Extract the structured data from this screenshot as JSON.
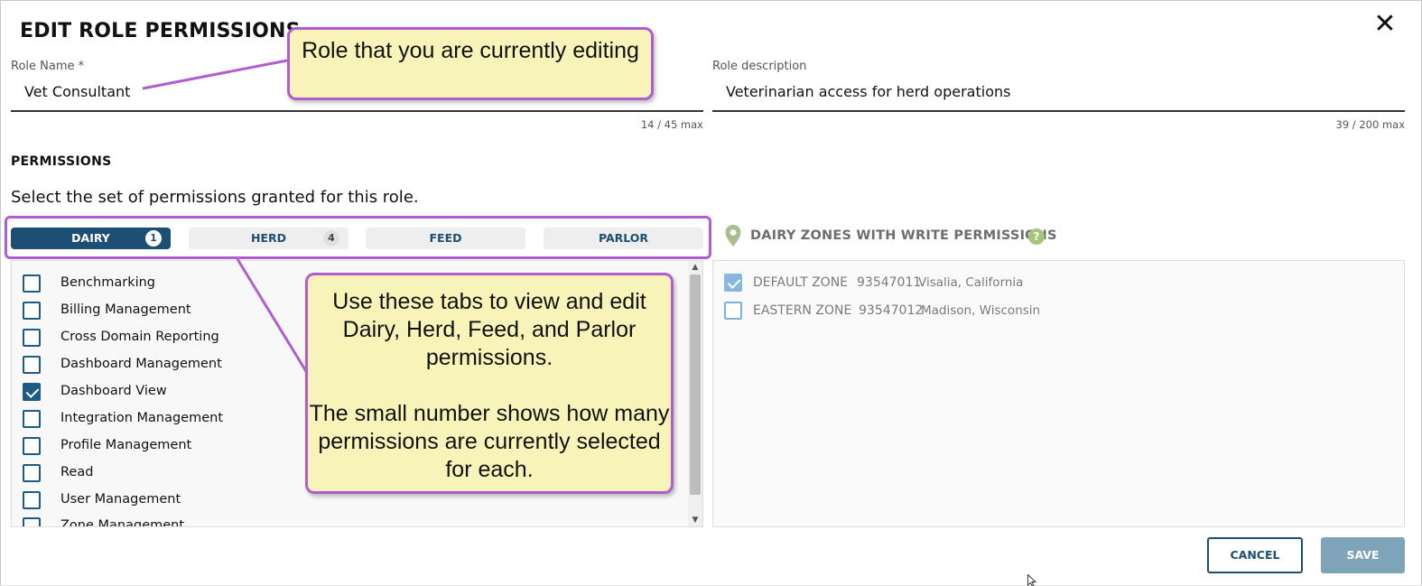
{
  "dialog": {
    "title": "EDIT ROLE PERMISSIONS",
    "close_glyph": "✕"
  },
  "role_name": {
    "label": "Role Name *",
    "value": "Vet Consultant",
    "counter": "14 / 45 max"
  },
  "role_description": {
    "label": "Role description",
    "value": "Veterinarian access for herd operations",
    "counter": "39 / 200 max"
  },
  "permissions": {
    "title": "PERMISSIONS",
    "subtitle": "Select the set of permissions granted for this role.",
    "tabs": [
      {
        "label": "DAIRY",
        "badge": "1",
        "active": true
      },
      {
        "label": "HERD",
        "badge": "4",
        "active": false
      },
      {
        "label": "FEED",
        "badge": "",
        "active": false
      },
      {
        "label": "PARLOR",
        "badge": "",
        "active": false
      }
    ],
    "items": [
      {
        "label": "Benchmarking",
        "checked": false
      },
      {
        "label": "Billing Management",
        "checked": false
      },
      {
        "label": "Cross Domain Reporting",
        "checked": false
      },
      {
        "label": "Dashboard Management",
        "checked": false
      },
      {
        "label": "Dashboard View",
        "checked": true
      },
      {
        "label": "Integration Management",
        "checked": false
      },
      {
        "label": "Profile Management",
        "checked": false
      },
      {
        "label": "Read",
        "checked": false
      },
      {
        "label": "User Management",
        "checked": false
      },
      {
        "label": "Zone Management",
        "checked": false
      }
    ]
  },
  "zones": {
    "title": "DAIRY ZONES WITH WRITE PERMISSIONS",
    "help_glyph": "?",
    "items": [
      {
        "name": "DEFAULT ZONE",
        "id": "93547011",
        "location": "Visalia, California",
        "checked": true
      },
      {
        "name": "EASTERN ZONE",
        "id": "93547012",
        "location": "Madison, Wisconsin",
        "checked": false
      }
    ]
  },
  "actions": {
    "cancel_label": "CANCEL",
    "save_label": "SAVE"
  },
  "callouts": {
    "role_callout": "Role that you are currently editing",
    "tabs_callout_p1": "Use these tabs to view and edit Dairy, Herd, Feed, and Parlor permissions.",
    "tabs_callout_p2": "The small number shows how many permissions are currently selected for each."
  },
  "colors": {
    "primary": "#1d4f74",
    "checkbox": "#1d5b86",
    "save_disabled": "#7fa4b9",
    "callout_fill": "#f7f3b9",
    "callout_border": "#b15dd0",
    "help_green": "#a6c57a"
  },
  "icons": {
    "close": "close-icon",
    "pin": "location-pin-icon",
    "help": "help-icon",
    "scroll_up": "chevron-up-icon",
    "scroll_down": "chevron-down-icon"
  }
}
